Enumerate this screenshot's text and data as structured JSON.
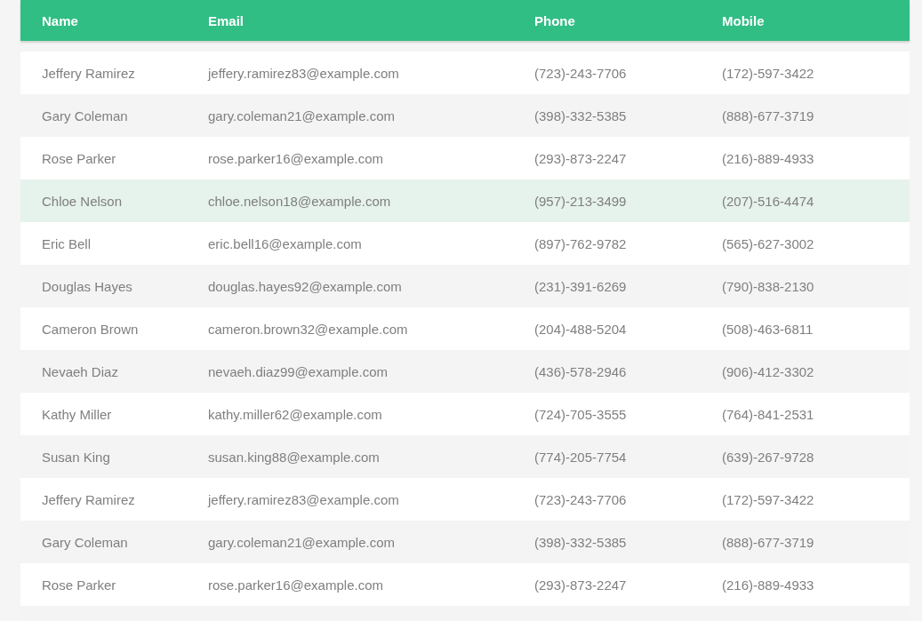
{
  "table": {
    "columns": [
      "Name",
      "Email",
      "Phone",
      "Mobile"
    ],
    "rows": [
      {
        "cells": [
          "Jeffery Ramirez",
          "jeffery.ramirez83@example.com",
          "(723)-243-7706",
          "(172)-597-3422"
        ],
        "highlighted": false
      },
      {
        "cells": [
          "Gary Coleman",
          "gary.coleman21@example.com",
          "(398)-332-5385",
          "(888)-677-3719"
        ],
        "highlighted": false
      },
      {
        "cells": [
          "Rose Parker",
          "rose.parker16@example.com",
          "(293)-873-2247",
          "(216)-889-4933"
        ],
        "highlighted": false
      },
      {
        "cells": [
          "Chloe Nelson",
          "chloe.nelson18@example.com",
          "(957)-213-3499",
          "(207)-516-4474"
        ],
        "highlighted": true
      },
      {
        "cells": [
          "Eric Bell",
          "eric.bell16@example.com",
          "(897)-762-9782",
          "(565)-627-3002"
        ],
        "highlighted": false
      },
      {
        "cells": [
          "Douglas Hayes",
          "douglas.hayes92@example.com",
          "(231)-391-6269",
          "(790)-838-2130"
        ],
        "highlighted": false
      },
      {
        "cells": [
          "Cameron Brown",
          "cameron.brown32@example.com",
          "(204)-488-5204",
          "(508)-463-6811"
        ],
        "highlighted": false
      },
      {
        "cells": [
          "Nevaeh Diaz",
          "nevaeh.diaz99@example.com",
          "(436)-578-2946",
          "(906)-412-3302"
        ],
        "highlighted": false
      },
      {
        "cells": [
          "Kathy Miller",
          "kathy.miller62@example.com",
          "(724)-705-3555",
          "(764)-841-2531"
        ],
        "highlighted": false
      },
      {
        "cells": [
          "Susan King",
          "susan.king88@example.com",
          "(774)-205-7754",
          "(639)-267-9728"
        ],
        "highlighted": false
      },
      {
        "cells": [
          "Jeffery Ramirez",
          "jeffery.ramirez83@example.com",
          "(723)-243-7706",
          "(172)-597-3422"
        ],
        "highlighted": false
      },
      {
        "cells": [
          "Gary Coleman",
          "gary.coleman21@example.com",
          "(398)-332-5385",
          "(888)-677-3719"
        ],
        "highlighted": false
      },
      {
        "cells": [
          "Rose Parker",
          "rose.parker16@example.com",
          "(293)-873-2247",
          "(216)-889-4933"
        ],
        "highlighted": false
      }
    ]
  }
}
